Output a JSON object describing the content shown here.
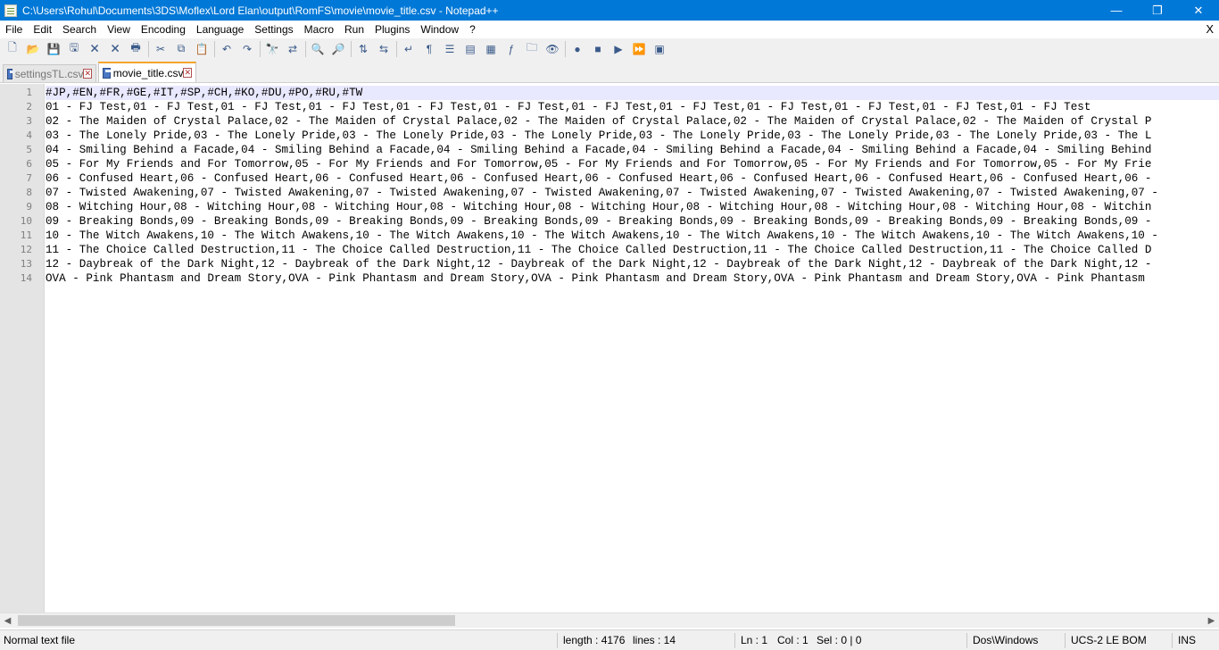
{
  "window": {
    "title": "C:\\Users\\Rohul\\Documents\\3DS\\Moflex\\Lord Elan\\output\\RomFS\\movie\\movie_title.csv - Notepad++",
    "minimize": "—",
    "restore": "❐",
    "close": "✕"
  },
  "menu": {
    "items": [
      "File",
      "Edit",
      "Search",
      "View",
      "Encoding",
      "Language",
      "Settings",
      "Macro",
      "Run",
      "Plugins",
      "Window",
      "?"
    ],
    "close_doc": "X"
  },
  "toolbar": {
    "buttons": [
      {
        "name": "new-file-icon",
        "glyph": "🗋"
      },
      {
        "name": "open-file-icon",
        "glyph": "📂"
      },
      {
        "name": "save-icon",
        "glyph": "💾"
      },
      {
        "name": "save-all-icon",
        "glyph": "🖫"
      },
      {
        "name": "close-file-icon",
        "glyph": "🗙"
      },
      {
        "name": "close-all-icon",
        "glyph": "🗙"
      },
      {
        "name": "print-icon",
        "glyph": "🖶"
      },
      {
        "name": "cut-icon",
        "glyph": "✂"
      },
      {
        "name": "copy-icon",
        "glyph": "⧉"
      },
      {
        "name": "paste-icon",
        "glyph": "📋"
      },
      {
        "name": "undo-icon",
        "glyph": "↶"
      },
      {
        "name": "redo-icon",
        "glyph": "↷"
      },
      {
        "name": "find-icon",
        "glyph": "🔭"
      },
      {
        "name": "replace-icon",
        "glyph": "⇄"
      },
      {
        "name": "zoom-in-icon",
        "glyph": "🔍"
      },
      {
        "name": "zoom-out-icon",
        "glyph": "🔎"
      },
      {
        "name": "sync-vertical-icon",
        "glyph": "⇅"
      },
      {
        "name": "sync-horizontal-icon",
        "glyph": "⇆"
      },
      {
        "name": "word-wrap-icon",
        "glyph": "↵"
      },
      {
        "name": "show-all-chars-icon",
        "glyph": "¶"
      },
      {
        "name": "indent-guide-icon",
        "glyph": "☰"
      },
      {
        "name": "user-language-icon",
        "glyph": "▤"
      },
      {
        "name": "doc-map-icon",
        "glyph": "▦"
      },
      {
        "name": "function-list-icon",
        "glyph": "ƒ"
      },
      {
        "name": "folder-workspace-icon",
        "glyph": "🗀"
      },
      {
        "name": "monitoring-icon",
        "glyph": "👁"
      },
      {
        "name": "record-macro-icon",
        "glyph": "●"
      },
      {
        "name": "stop-macro-icon",
        "glyph": "■"
      },
      {
        "name": "play-macro-icon",
        "glyph": "▶"
      },
      {
        "name": "run-macro-multiple-icon",
        "glyph": "⏩"
      },
      {
        "name": "save-macro-icon",
        "glyph": "▣"
      }
    ]
  },
  "tabs": [
    {
      "label": "settingsTL.csv",
      "active": false
    },
    {
      "label": "movie_title.csv",
      "active": true
    }
  ],
  "editor": {
    "current_line": 1,
    "lines": [
      "#JP,#EN,#FR,#GE,#IT,#SP,#CH,#KO,#DU,#PO,#RU,#TW",
      "01 - FJ Test,01 - FJ Test,01 - FJ Test,01 - FJ Test,01 - FJ Test,01 - FJ Test,01 - FJ Test,01 - FJ Test,01 - FJ Test,01 - FJ Test,01 - FJ Test,01 - FJ Test",
      "02 - The Maiden of Crystal Palace,02 - The Maiden of Crystal Palace,02 - The Maiden of Crystal Palace,02 - The Maiden of Crystal Palace,02 - The Maiden of Crystal P",
      "03 - The Lonely Pride,03 - The Lonely Pride,03 - The Lonely Pride,03 - The Lonely Pride,03 - The Lonely Pride,03 - The Lonely Pride,03 - The Lonely Pride,03 - The L",
      "04 - Smiling Behind a Facade,04 - Smiling Behind a Facade,04 - Smiling Behind a Facade,04 - Smiling Behind a Facade,04 - Smiling Behind a Facade,04 - Smiling Behind",
      "05 - For My Friends and For Tomorrow,05 - For My Friends and For Tomorrow,05 - For My Friends and For Tomorrow,05 - For My Friends and For Tomorrow,05 - For My Frie",
      "06 - Confused Heart,06 - Confused Heart,06 - Confused Heart,06 - Confused Heart,06 - Confused Heart,06 - Confused Heart,06 - Confused Heart,06 - Confused Heart,06 -",
      "07 - Twisted Awakening,07 - Twisted Awakening,07 - Twisted Awakening,07 - Twisted Awakening,07 - Twisted Awakening,07 - Twisted Awakening,07 - Twisted Awakening,07 -",
      "08 - Witching Hour,08 - Witching Hour,08 - Witching Hour,08 - Witching Hour,08 - Witching Hour,08 - Witching Hour,08 - Witching Hour,08 - Witching Hour,08 - Witchin",
      "09 - Breaking Bonds,09 - Breaking Bonds,09 - Breaking Bonds,09 - Breaking Bonds,09 - Breaking Bonds,09 - Breaking Bonds,09 - Breaking Bonds,09 - Breaking Bonds,09 -",
      "10 - The Witch Awakens,10 - The Witch Awakens,10 - The Witch Awakens,10 - The Witch Awakens,10 - The Witch Awakens,10 - The Witch Awakens,10 - The Witch Awakens,10 -",
      "11 - The Choice Called Destruction,11 - The Choice Called Destruction,11 - The Choice Called Destruction,11 - The Choice Called Destruction,11 - The Choice Called D",
      "12 - Daybreak of the Dark Night,12 - Daybreak of the Dark Night,12 - Daybreak of the Dark Night,12 - Daybreak of the Dark Night,12 - Daybreak of the Dark Night,12 -",
      "OVA - Pink Phantasm and Dream Story,OVA - Pink Phantasm and Dream Story,OVA - Pink Phantasm and Dream Story,OVA - Pink Phantasm and Dream Story,OVA - Pink Phantasm"
    ]
  },
  "scrollbar": {
    "left_arrow": "◀",
    "right_arrow": "▶"
  },
  "status": {
    "file_type": "Normal text file",
    "length": "length : 4176",
    "lines": "lines : 14",
    "ln": "Ln : 1",
    "col": "Col : 1",
    "sel": "Sel : 0 | 0",
    "eol": "Dos\\Windows",
    "encoding": "UCS-2 LE BOM",
    "mode": "INS"
  }
}
